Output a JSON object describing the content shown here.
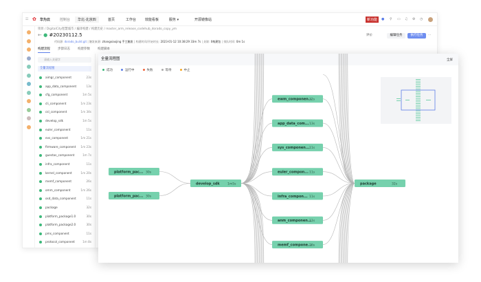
{
  "topbar": {
    "brand": "华为云",
    "console": "控制台",
    "region": "华北-北京四",
    "nav": [
      "首页",
      "工作台",
      "效能看板",
      "服务 ▾"
    ],
    "promo": "开源镜像站",
    "new_badge": "新功能"
  },
  "breadcrumb": "项目 / DigitalCity智慧城市 / 编译构建 / 构建历史 / master_arm_release_codehub_dorado_copy_ym",
  "build": {
    "title": "#20230112.5",
    "code_source_label": "代码源:",
    "code_source": "dorado_build.git",
    "trigger_label": "触发来源:",
    "trigger": "zhangxiaojing 手工触发",
    "start_label": "构建时间/开始时长:",
    "start": "2023-01-12 10:38:29",
    "duration": "33m 7s",
    "result_label": "关联:",
    "result": "0构建包",
    "queue_label": "排队时间:",
    "queue": "0m 1s"
  },
  "actions": {
    "rate": "评价",
    "edit": "编辑任务",
    "run": "执行任务",
    "more": "···"
  },
  "tabs": [
    "构建流程",
    "步骤日志",
    "构建参数",
    "构建脚本"
  ],
  "sidebar": {
    "search_placeholder": "请输入关键字",
    "all_flow": "全量流程图",
    "items": [
      {
        "name": "aimgr_component",
        "time": "23s"
      },
      {
        "name": "app_data_component",
        "time": "13s"
      },
      {
        "name": "cfg_component",
        "time": "1m 5s"
      },
      {
        "name": "cli_component",
        "time": "1m 23s"
      },
      {
        "name": "csl_component",
        "time": "1m 34s"
      },
      {
        "name": "develop_sdk",
        "time": "1m 5s"
      },
      {
        "name": "euler_component",
        "time": "11s"
      },
      {
        "name": "evs_component",
        "time": "1m 21s"
      },
      {
        "name": "firmware_component",
        "time": "1m 23s"
      },
      {
        "name": "guestos_component",
        "time": "1m 7s"
      },
      {
        "name": "infra_component",
        "time": "11s"
      },
      {
        "name": "kernel_component",
        "time": "1m 20s"
      },
      {
        "name": "memf_component",
        "time": "26s"
      },
      {
        "name": "omm_component",
        "time": "1m 26s"
      },
      {
        "name": "osd_data_component",
        "time": "11s"
      },
      {
        "name": "package",
        "time": "32s"
      },
      {
        "name": "platform_package1.0",
        "time": "30s"
      },
      {
        "name": "platform_package2.0",
        "time": "30s"
      },
      {
        "name": "pms_component",
        "time": "11s"
      },
      {
        "name": "protocol_component",
        "time": "1m 8s"
      }
    ]
  },
  "flow": {
    "title": "全量流程图",
    "fullscreen": "全屏",
    "legend": [
      {
        "label": "成功",
        "color": "#3db87a"
      },
      {
        "label": "运行中",
        "color": "#5b7de8"
      },
      {
        "label": "失败",
        "color": "#f0643c"
      },
      {
        "label": "等待",
        "color": "#aaaaaa"
      },
      {
        "label": "中止",
        "color": "#f5a623"
      }
    ],
    "node_color": "#76d1ad",
    "sources": [
      {
        "name": "platform_pac...",
        "time": "30s"
      },
      {
        "name": "platform_pac...",
        "time": "30s"
      }
    ],
    "center": {
      "name": "develop_sdk",
      "time": "1m5s"
    },
    "middle": [
      {
        "name": "",
        "time": ""
      },
      {
        "name": "ewm_componen...",
        "time": "32s"
      },
      {
        "name": "app_data_com...",
        "time": "13s"
      },
      {
        "name": "sys_componen...",
        "time": "11s"
      },
      {
        "name": "euler_compon...",
        "time": "11s"
      },
      {
        "name": "infra_compon...",
        "time": "11s"
      },
      {
        "name": "anm_componen...",
        "time": "11s"
      },
      {
        "name": "memf_compone...",
        "time": "26s"
      }
    ],
    "sink": {
      "name": "package",
      "time": "32s"
    }
  }
}
